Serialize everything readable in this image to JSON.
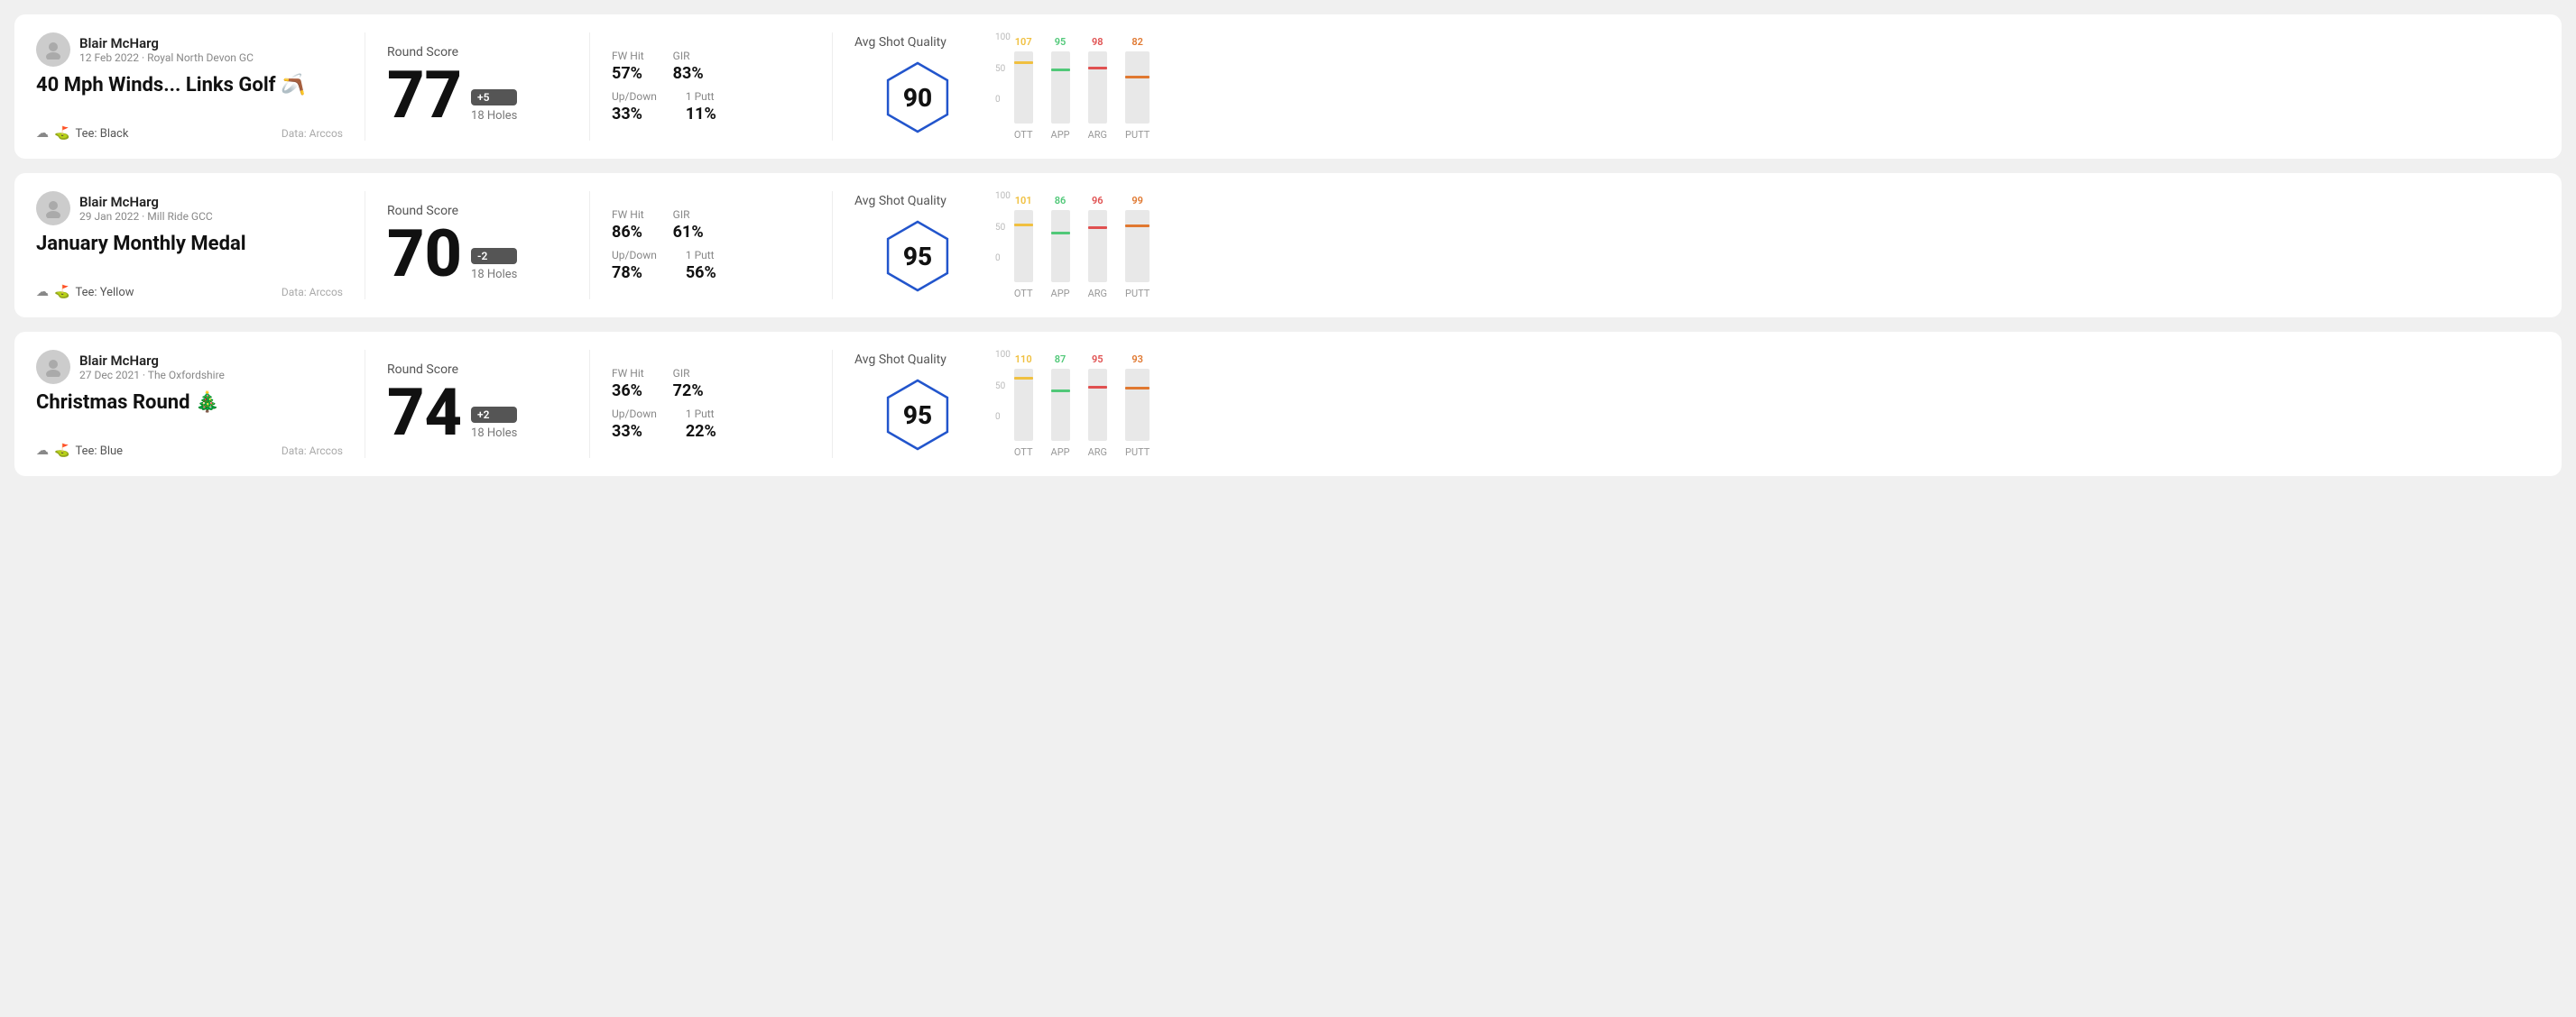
{
  "rounds": [
    {
      "id": "round1",
      "user": {
        "name": "Blair McHarg",
        "date": "12 Feb 2022 · Royal North Devon GC"
      },
      "title": "40 Mph Winds... Links Golf 🪃",
      "tee": "Black",
      "data_source": "Data: Arccos",
      "score": {
        "value": "77",
        "diff": "+5",
        "holes": "18 Holes"
      },
      "stats": {
        "fw_hit": "57%",
        "gir": "83%",
        "updown": "33%",
        "one_putt": "11%"
      },
      "avg_shot_quality": "90",
      "chart": {
        "bars": [
          {
            "label": "OTT",
            "value": 107,
            "color": "#f0c040",
            "max": 130
          },
          {
            "label": "APP",
            "value": 95,
            "color": "#50c878",
            "max": 130
          },
          {
            "label": "ARG",
            "value": 98,
            "color": "#e05050",
            "max": 130
          },
          {
            "label": "PUTT",
            "value": 82,
            "color": "#e07830",
            "max": 130
          }
        ]
      }
    },
    {
      "id": "round2",
      "user": {
        "name": "Blair McHarg",
        "date": "29 Jan 2022 · Mill Ride GCC"
      },
      "title": "January Monthly Medal",
      "tee": "Yellow",
      "data_source": "Data: Arccos",
      "score": {
        "value": "70",
        "diff": "-2",
        "holes": "18 Holes"
      },
      "stats": {
        "fw_hit": "86%",
        "gir": "61%",
        "updown": "78%",
        "one_putt": "56%"
      },
      "avg_shot_quality": "95",
      "chart": {
        "bars": [
          {
            "label": "OTT",
            "value": 101,
            "color": "#f0c040",
            "max": 130
          },
          {
            "label": "APP",
            "value": 86,
            "color": "#50c878",
            "max": 130
          },
          {
            "label": "ARG",
            "value": 96,
            "color": "#e05050",
            "max": 130
          },
          {
            "label": "PUTT",
            "value": 99,
            "color": "#e07830",
            "max": 130
          }
        ]
      }
    },
    {
      "id": "round3",
      "user": {
        "name": "Blair McHarg",
        "date": "27 Dec 2021 · The Oxfordshire"
      },
      "title": "Christmas Round 🎄",
      "tee": "Blue",
      "data_source": "Data: Arccos",
      "score": {
        "value": "74",
        "diff": "+2",
        "holes": "18 Holes"
      },
      "stats": {
        "fw_hit": "36%",
        "gir": "72%",
        "updown": "33%",
        "one_putt": "22%"
      },
      "avg_shot_quality": "95",
      "chart": {
        "bars": [
          {
            "label": "OTT",
            "value": 110,
            "color": "#f0c040",
            "max": 130
          },
          {
            "label": "APP",
            "value": 87,
            "color": "#50c878",
            "max": 130
          },
          {
            "label": "ARG",
            "value": 95,
            "color": "#e05050",
            "max": 130
          },
          {
            "label": "PUTT",
            "value": 93,
            "color": "#e07830",
            "max": 130
          }
        ]
      }
    }
  ],
  "labels": {
    "round_score": "Round Score",
    "fw_hit": "FW Hit",
    "gir": "GIR",
    "updown": "Up/Down",
    "one_putt": "1 Putt",
    "avg_shot_quality": "Avg Shot Quality",
    "tee_prefix": "Tee:",
    "data_source": "Data: Arccos"
  }
}
